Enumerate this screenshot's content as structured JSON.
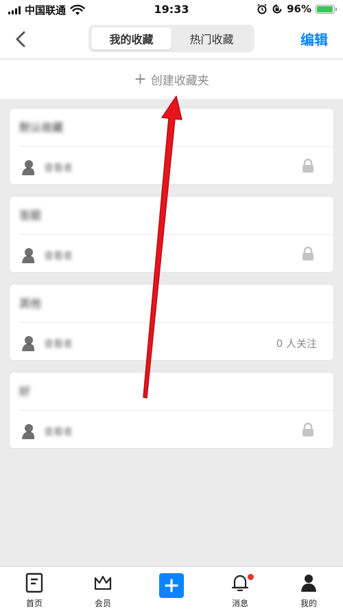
{
  "status_bar": {
    "carrier": "中国联通",
    "time": "19:33",
    "battery": "96%",
    "battery_level": 0.96
  },
  "nav": {
    "back_icon": "chevron-left-icon",
    "tabs": [
      {
        "label": "我的收藏",
        "active": true
      },
      {
        "label": "热门收藏",
        "active": false
      }
    ],
    "edit_label": "编辑"
  },
  "create": {
    "plus": "+",
    "label": "创建收藏夹"
  },
  "folders": [
    {
      "title": "默认收藏",
      "owner": "查看者",
      "status": "lock"
    },
    {
      "title": "答题",
      "owner": "查看者",
      "status": "lock"
    },
    {
      "title": "其他",
      "owner": "查看者",
      "follow": "0 人关注"
    },
    {
      "title": "好",
      "owner": "查看者",
      "status": "lock"
    }
  ],
  "tab_bar": {
    "items": [
      {
        "label": "首页",
        "icon": "home-doc-icon"
      },
      {
        "label": "会员",
        "icon": "crown-icon"
      },
      {
        "label": "",
        "icon": "plus-icon"
      },
      {
        "label": "消息",
        "icon": "bell-icon"
      },
      {
        "label": "我的",
        "icon": "person-icon"
      }
    ]
  },
  "colors": {
    "accent": "#0a84ff",
    "background": "#ebebeb",
    "annotation_arrow": "#e8141c",
    "notification_dot": "#f0302e",
    "battery_fill": "#35c759"
  }
}
